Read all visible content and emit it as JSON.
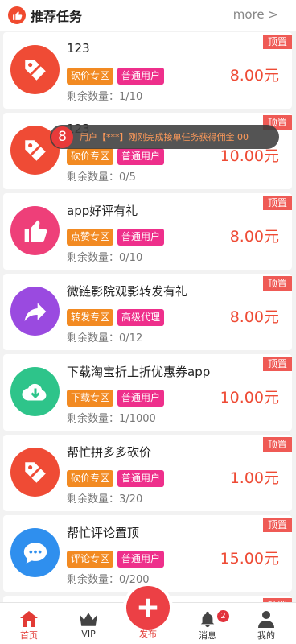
{
  "header": {
    "title": "推荐任务",
    "more": "more >"
  },
  "toast": {
    "badge": "8",
    "message": "用户【***】刚刚完成接单任务获得佣金 00"
  },
  "remain_label": "剩余数量：",
  "pin_label": "顶置",
  "tasks": [
    {
      "title": "123",
      "tag1": "砍价专区",
      "tag2": "普通用户",
      "remain": "1/10",
      "price": "8.00元",
      "icon": "tag-discount-icon",
      "color": "#ef4b35"
    },
    {
      "title": "123",
      "tag1": "砍价专区",
      "tag2": "普通用户",
      "remain": "0/5",
      "price": "10.00元",
      "icon": "tag-discount-icon",
      "color": "#ef4b35"
    },
    {
      "title": "app好评有礼",
      "tag1": "点赞专区",
      "tag2": "普通用户",
      "remain": "0/10",
      "price": "8.00元",
      "icon": "thumbs-up-icon",
      "color": "#ee3f79"
    },
    {
      "title": "微链影院观影转发有礼",
      "tag1": "转发专区",
      "tag2": "高级代理",
      "remain": "0/12",
      "price": "8.00元",
      "icon": "share-arrow-icon",
      "color": "#9a4ae0"
    },
    {
      "title": "下载淘宝折上折优惠券app",
      "tag1": "下载专区",
      "tag2": "普通用户",
      "remain": "1/1000",
      "price": "10.00元",
      "icon": "download-icon",
      "color": "#2ec48a"
    },
    {
      "title": "帮忙拼多多砍价",
      "tag1": "砍价专区",
      "tag2": "普通用户",
      "remain": "3/20",
      "price": "1.00元",
      "icon": "tag-discount-icon",
      "color": "#ef4b35"
    },
    {
      "title": "帮忙评论置顶",
      "tag1": "评论专区",
      "tag2": "普通用户",
      "remain": "0/200",
      "price": "15.00元",
      "icon": "chat-bubble-icon",
      "color": "#2f8fee"
    }
  ],
  "tabbar": {
    "home": "首页",
    "vip": "VIP",
    "publish": "发布",
    "messages": "消息",
    "messages_badge": "2",
    "mine": "我的"
  },
  "colors": {
    "accent": "#ee4b35",
    "tag_orange": "#f28a22",
    "tag_pink": "#ee2f8b"
  }
}
